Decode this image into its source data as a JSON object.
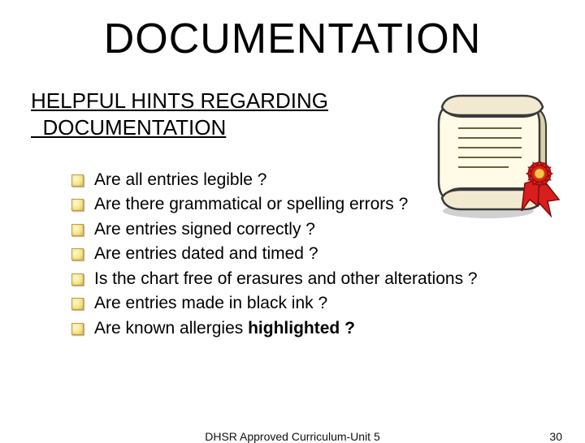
{
  "title": "DOCUMENTATION",
  "subtitle_line1": "HELPFUL HINTS REGARDING",
  "subtitle_line2": "DOCUMENTATION",
  "bullets": {
    "0": "Are all entries legible ?",
    "1": "Are there grammatical or spelling errors ?",
    "2": "Are entries signed correctly ?",
    "3": "Are entries dated and timed ?",
    "4": "Is the chart free of erasures and other alterations ?",
    "5": "Are entries made in black ink ?",
    "6_a": "Are known allergies ",
    "6_b": "highlighted ?"
  },
  "footer_center": "DHSR Approved Curriculum-Unit 5",
  "footer_right": "30"
}
